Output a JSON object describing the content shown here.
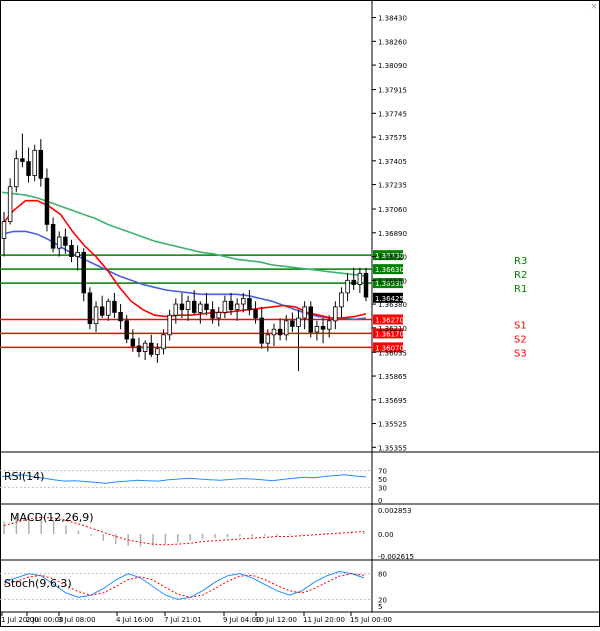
{
  "chart_data": {
    "type": "candlestick",
    "symbol_note": "",
    "price_ticks": [
      "1.38430",
      "1.38260",
      "1.38090",
      "1.37915",
      "1.37745",
      "1.37575",
      "1.37405",
      "1.37235",
      "1.37060",
      "1.36890",
      "1.36720",
      "1.36550",
      "1.36380",
      "1.36210",
      "1.36035",
      "1.35865",
      "1.35695",
      "1.35525",
      "1.35355"
    ],
    "price_range": [
      1.353,
      1.3852
    ],
    "current_price": "1.36425",
    "time_labels": [
      "1 Jul 20:00",
      "2 Jul 00:00",
      "3 Jul 08:00",
      "4 Jul 16:00",
      "7 Jul 21:01",
      "9 Jul 04:00",
      "10 Jul 12:00",
      "11 Jul 20:00",
      "15 Jul 00:00"
    ],
    "levels": [
      {
        "name": "R3",
        "value": 1.3673,
        "label": "1.36730",
        "color": "#008000"
      },
      {
        "name": "R2",
        "value": 1.3663,
        "label": "1.36630",
        "color": "#008000"
      },
      {
        "name": "R1",
        "value": 1.3653,
        "label": "1.36530",
        "color": "#008000"
      },
      {
        "name": "S1",
        "value": 1.3627,
        "label": "1.36270",
        "color": "#ff0000"
      },
      {
        "name": "S2",
        "value": 1.3617,
        "label": "1.36170",
        "color": "#ff0000"
      },
      {
        "name": "S3",
        "value": 1.3607,
        "label": "1.36070",
        "color": "#ff0000"
      }
    ],
    "candles": [
      [
        1.3685,
        1.3704,
        1.3672,
        1.3697
      ],
      [
        1.3697,
        1.3728,
        1.3695,
        1.3722
      ],
      [
        1.3722,
        1.3748,
        1.3718,
        1.3742
      ],
      [
        1.3742,
        1.376,
        1.3736,
        1.374
      ],
      [
        1.374,
        1.375,
        1.3725,
        1.373
      ],
      [
        1.373,
        1.3752,
        1.3726,
        1.3748
      ],
      [
        1.3748,
        1.3756,
        1.3722,
        1.3728
      ],
      [
        1.3728,
        1.3735,
        1.369,
        1.3695
      ],
      [
        1.3695,
        1.37,
        1.3675,
        1.3678
      ],
      [
        1.3678,
        1.369,
        1.3672,
        1.3686
      ],
      [
        1.3686,
        1.3692,
        1.3674,
        1.368
      ],
      [
        1.368,
        1.3684,
        1.3668,
        1.3672
      ],
      [
        1.3672,
        1.368,
        1.3662,
        1.3675
      ],
      [
        1.3675,
        1.3678,
        1.364,
        1.3646
      ],
      [
        1.3646,
        1.365,
        1.362,
        1.3624
      ],
      [
        1.3624,
        1.364,
        1.3618,
        1.3636
      ],
      [
        1.3636,
        1.3644,
        1.3628,
        1.363
      ],
      [
        1.363,
        1.3642,
        1.3626,
        1.364
      ],
      [
        1.364,
        1.3646,
        1.3628,
        1.3632
      ],
      [
        1.3632,
        1.3638,
        1.362,
        1.3626
      ],
      [
        1.3626,
        1.363,
        1.361,
        1.3613
      ],
      [
        1.3613,
        1.362,
        1.3604,
        1.3608
      ],
      [
        1.3608,
        1.3614,
        1.36,
        1.3604
      ],
      [
        1.3604,
        1.3612,
        1.3598,
        1.361
      ],
      [
        1.361,
        1.3616,
        1.36,
        1.3602
      ],
      [
        1.3602,
        1.361,
        1.3596,
        1.3606
      ],
      [
        1.3606,
        1.362,
        1.3602,
        1.3616
      ],
      [
        1.3616,
        1.3634,
        1.3612,
        1.363
      ],
      [
        1.363,
        1.3642,
        1.3624,
        1.3638
      ],
      [
        1.3638,
        1.3646,
        1.3628,
        1.3634
      ],
      [
        1.3634,
        1.3644,
        1.3626,
        1.364
      ],
      [
        1.364,
        1.3648,
        1.363,
        1.3632
      ],
      [
        1.3632,
        1.364,
        1.3624,
        1.3638
      ],
      [
        1.3638,
        1.3646,
        1.363,
        1.3634
      ],
      [
        1.3634,
        1.364,
        1.3624,
        1.3628
      ],
      [
        1.3628,
        1.3636,
        1.3622,
        1.3632
      ],
      [
        1.3632,
        1.3644,
        1.3628,
        1.364
      ],
      [
        1.364,
        1.3646,
        1.363,
        1.3634
      ],
      [
        1.3634,
        1.3642,
        1.3626,
        1.3638
      ],
      [
        1.3638,
        1.3646,
        1.3632,
        1.3642
      ],
      [
        1.3642,
        1.3648,
        1.363,
        1.3634
      ],
      [
        1.3634,
        1.364,
        1.3624,
        1.3628
      ],
      [
        1.3628,
        1.3636,
        1.3606,
        1.361
      ],
      [
        1.361,
        1.362,
        1.3604,
        1.3616
      ],
      [
        1.3616,
        1.3624,
        1.3608,
        1.362
      ],
      [
        1.362,
        1.3628,
        1.3612,
        1.3616
      ],
      [
        1.3616,
        1.363,
        1.3612,
        1.3626
      ],
      [
        1.3626,
        1.3632,
        1.3618,
        1.3622
      ],
      [
        1.3622,
        1.3634,
        1.359,
        1.3628
      ],
      [
        1.3628,
        1.364,
        1.362,
        1.3636
      ],
      [
        1.3636,
        1.364,
        1.3614,
        1.3618
      ],
      [
        1.3618,
        1.3626,
        1.3612,
        1.3622
      ],
      [
        1.3622,
        1.3628,
        1.361,
        1.362
      ],
      [
        1.362,
        1.363,
        1.3614,
        1.3626
      ],
      [
        1.3626,
        1.364,
        1.362,
        1.3636
      ],
      [
        1.3636,
        1.365,
        1.3628,
        1.3646
      ],
      [
        1.3646,
        1.366,
        1.364,
        1.3655
      ],
      [
        1.3655,
        1.3664,
        1.3648,
        1.3652
      ],
      [
        1.3652,
        1.3664,
        1.3646,
        1.366
      ],
      [
        1.366,
        1.3664,
        1.364,
        1.3643
      ]
    ],
    "ma_fast_color": "#ff0000",
    "ma_mid_color": "#4a5ee0",
    "ma_slow_color": "#3cb371",
    "ma_fast": [
      1.3695,
      1.3705,
      1.3712,
      1.3712,
      1.3708,
      1.3702,
      1.369,
      1.368,
      1.3672,
      1.3662,
      1.365,
      1.364,
      1.3634,
      1.363,
      1.3629,
      1.363,
      1.363,
      1.3631,
      1.3632,
      1.3632,
      1.3633,
      1.3634,
      1.3635,
      1.3636,
      1.3637,
      1.3636,
      1.3632,
      1.363,
      1.3628,
      1.3628,
      1.3629,
      1.3631
    ],
    "ma_mid": [
      1.3688,
      1.369,
      1.369,
      1.3688,
      1.3684,
      1.3679,
      1.3674,
      1.367,
      1.3666,
      1.3662,
      1.3658,
      1.3655,
      1.3652,
      1.365,
      1.3648,
      1.3647,
      1.3646,
      1.3645,
      1.3645,
      1.3645,
      1.3645,
      1.3644,
      1.3642,
      1.364,
      1.3637,
      1.3634,
      1.3631,
      1.3629,
      1.3628,
      1.3628,
      1.3627,
      1.3628
    ],
    "ma_slow": [
      1.3718,
      1.3717,
      1.3716,
      1.3714,
      1.3711,
      1.3708,
      1.3705,
      1.3702,
      1.3699,
      1.3695,
      1.3692,
      1.3689,
      1.3686,
      1.3683,
      1.3681,
      1.3679,
      1.3677,
      1.3675,
      1.3674,
      1.3672,
      1.367,
      1.3669,
      1.3668,
      1.3666,
      1.3665,
      1.3664,
      1.3663,
      1.3662,
      1.3661,
      1.366,
      1.3659,
      1.3658
    ],
    "rsi": {
      "label": "RSI(14)",
      "ticks": [
        "70",
        "50",
        "30",
        "0"
      ],
      "values": [
        56,
        58,
        60,
        55,
        52,
        48,
        45,
        46,
        44,
        42,
        40,
        43,
        45,
        47,
        46,
        45,
        48,
        50,
        52,
        50,
        48,
        47,
        49,
        51,
        50,
        48,
        46,
        49,
        52,
        54,
        53,
        56,
        58,
        60,
        57,
        55
      ]
    },
    "macd": {
      "label": "MACD(12,26,9)",
      "ticks": [
        "0.002853",
        "0.00",
        "-0.002615"
      ],
      "histogram": [
        0.0015,
        0.002,
        0.0022,
        0.002,
        0.0016,
        0.001,
        0.0004,
        -0.0002,
        -0.0008,
        -0.0012,
        -0.0014,
        -0.0015,
        -0.0014,
        -0.0012,
        -0.001,
        -0.0008,
        -0.0006,
        -0.0005,
        -0.0004,
        -0.0003,
        -0.0003,
        -0.0002,
        -0.0002,
        -0.0001,
        -0.0001,
        0.0,
        0.0001,
        0.0002,
        0.0003,
        0.0003
      ],
      "signal": [
        0.001,
        0.0014,
        0.0018,
        0.002,
        0.0019,
        0.0016,
        0.0012,
        0.0007,
        0.0002,
        -0.0003,
        -0.0007,
        -0.001,
        -0.0012,
        -0.0013,
        -0.0012,
        -0.0011,
        -0.0009,
        -0.0008,
        -0.0007,
        -0.0006,
        -0.0005,
        -0.0004,
        -0.0003,
        -0.0003,
        -0.0002,
        -0.0001,
        0.0,
        0.0001,
        0.0002,
        0.0003
      ]
    },
    "stoch": {
      "label": "Stoch(9,6,3)",
      "ticks": [
        "80",
        "20",
        "5"
      ],
      "k": [
        60,
        70,
        80,
        75,
        55,
        35,
        25,
        30,
        45,
        65,
        80,
        70,
        50,
        30,
        20,
        25,
        40,
        60,
        75,
        80,
        70,
        55,
        40,
        30,
        40,
        60,
        75,
        85,
        80,
        70
      ],
      "d": [
        55,
        62,
        72,
        76,
        68,
        52,
        38,
        30,
        35,
        50,
        66,
        72,
        65,
        48,
        32,
        25,
        30,
        45,
        62,
        74,
        76,
        66,
        52,
        40,
        35,
        45,
        60,
        74,
        80,
        76
      ]
    }
  }
}
